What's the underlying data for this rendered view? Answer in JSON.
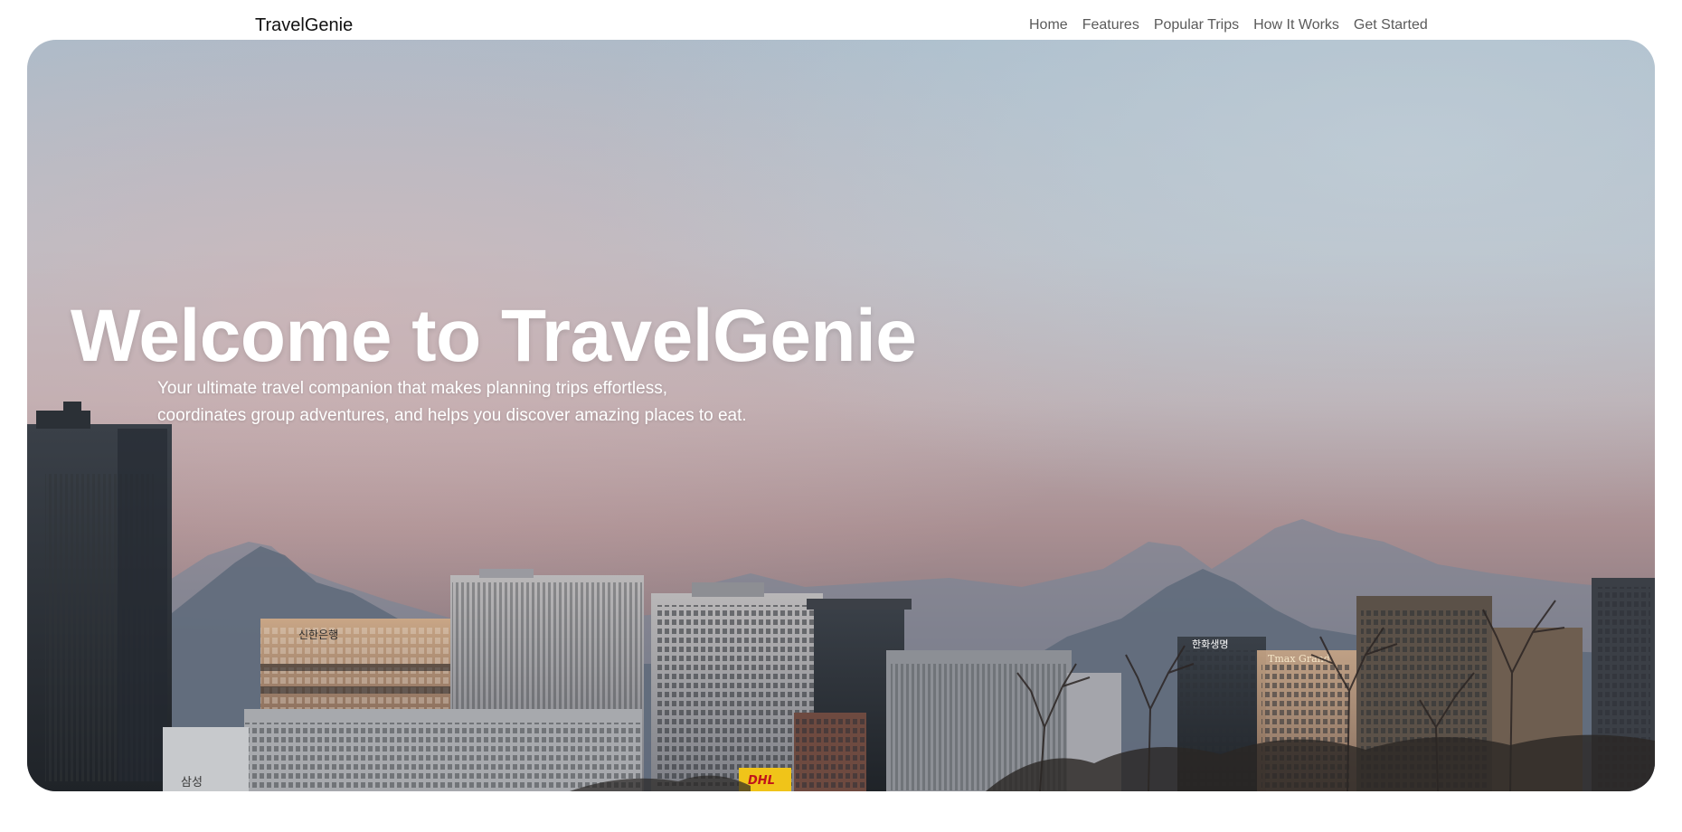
{
  "nav": {
    "brand": "TravelGenie",
    "links": [
      {
        "label": "Home"
      },
      {
        "label": "Features"
      },
      {
        "label": "Popular Trips"
      },
      {
        "label": "How It Works"
      },
      {
        "label": "Get Started"
      }
    ]
  },
  "hero": {
    "title": "Welcome to TravelGenie",
    "subtitle_line1": "Your ultimate travel companion that makes planning trips effortless,",
    "subtitle_line2": "coordinates group adventures, and helps you discover amazing places to eat.",
    "background_image": "city-skyline-with-mountains-photo",
    "signs": {
      "bank": "신한은행",
      "insurer": "한화생명",
      "courier": "DHL",
      "street": "삼성",
      "tower": "Tmax Grand"
    }
  },
  "colors": {
    "sky_top": "#a9bccb",
    "sky_mid": "#c2b0b2",
    "sky_low": "#a88c8f",
    "mountains": "#5e6a7a",
    "buildings": "#2c3137",
    "nav_text": "#5a5a5a",
    "hero_text": "#ffffff"
  }
}
